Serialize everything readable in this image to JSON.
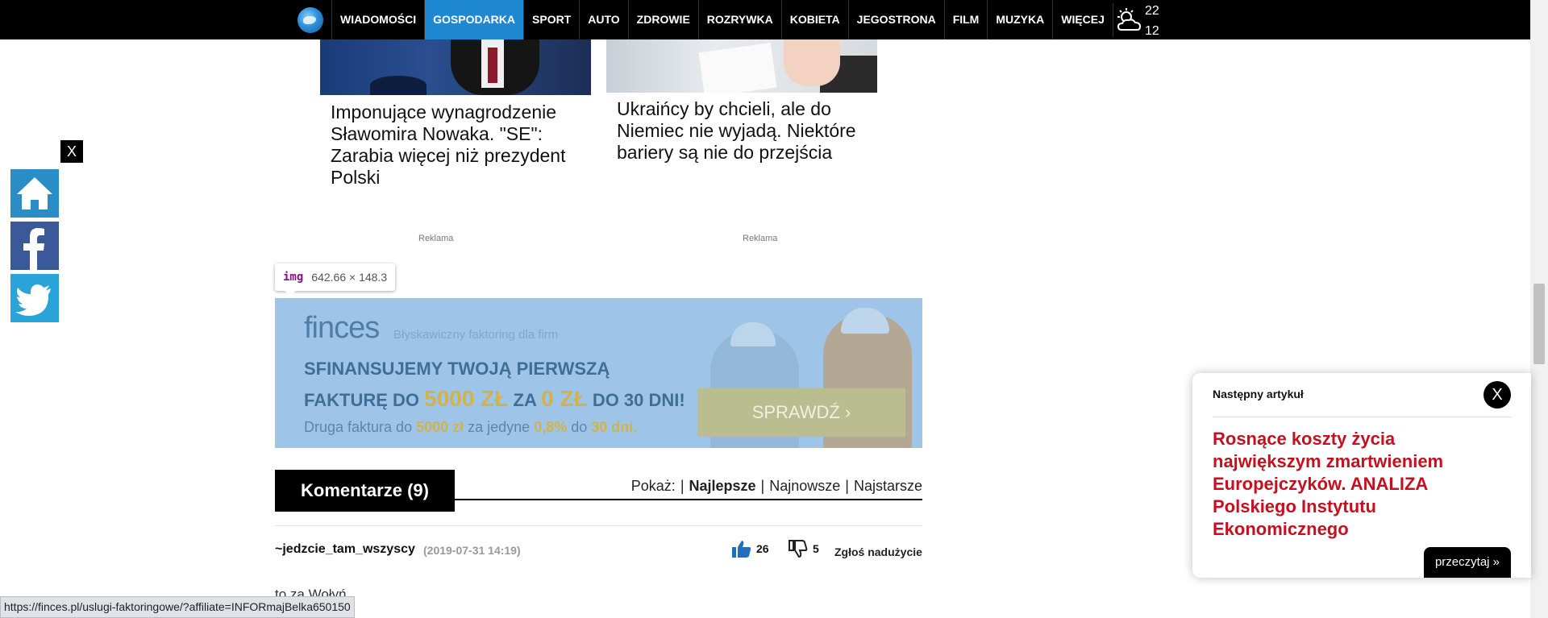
{
  "nav": {
    "items": [
      {
        "label": "WIADOMOŚCI",
        "active": false
      },
      {
        "label": "GOSPODARKA",
        "active": true
      },
      {
        "label": "SPORT",
        "active": false
      },
      {
        "label": "AUTO",
        "active": false
      },
      {
        "label": "ZDROWIE",
        "active": false
      },
      {
        "label": "ROZRYWKA",
        "active": false
      },
      {
        "label": "KOBIETA",
        "active": false
      },
      {
        "label": "JEGOSTRONA",
        "active": false
      },
      {
        "label": "FILM",
        "active": false
      },
      {
        "label": "MUZYKA",
        "active": false
      },
      {
        "label": "WIĘCEJ",
        "active": false
      }
    ],
    "weather": {
      "high": "22",
      "low": "12",
      "icon": "partly-cloudy-icon"
    },
    "accent": "#1e88d2"
  },
  "social": {
    "close_label": "X",
    "buttons": [
      "home-icon",
      "facebook-icon",
      "twitter-icon"
    ]
  },
  "articles": [
    {
      "title": "Imponujące wynagrodzenie Sławomira Nowaka. \"SE\": Zarabia więcej niż prezydent Polski"
    },
    {
      "title": "Ukraińcy by chcieli, ale do Niemiec nie wyjadą. Niektóre bariery są nie do przejścia"
    }
  ],
  "ads": {
    "label_left": "Reklama",
    "label_right": "Reklama"
  },
  "tooltip": {
    "tag": "img",
    "dimensions": "642.66 × 148.3"
  },
  "banner": {
    "logo": "finces",
    "tagline": "Błyskawiczny faktoring dla firm",
    "headline1": "SFINANSUJEMY TWOJĄ PIERWSZĄ",
    "headline2_a": "FAKTURĘ DO ",
    "headline2_b": "5000 ZŁ",
    "headline2_c": " ZA ",
    "headline2_d": "0 ZŁ",
    "headline2_e": " DO 30 DNI!",
    "sub_a": "Druga faktura do ",
    "sub_b": "5000 zł",
    "sub_c": " za jedyne ",
    "sub_d": "0,8%",
    "sub_e": " do ",
    "sub_f": "30 dni.",
    "cta": "SPRAWDŹ ›"
  },
  "comments": {
    "title": "Komentarze (9)",
    "show_label": "Pokaż:",
    "sort_options": [
      {
        "label": "Najlepsze",
        "active": true
      },
      {
        "label": "Najnowsze",
        "active": false
      },
      {
        "label": "Najstarsze",
        "active": false
      }
    ],
    "items": [
      {
        "author": "~jedzcie_tam_wszyscy",
        "date": "(2019-07-31 14:19)",
        "likes": "26",
        "dislikes": "5",
        "report": "Zgłoś nadużycie",
        "text": "to za Wołyń"
      }
    ]
  },
  "status_url": "https://finces.pl/uslugi-faktoringowe/?affiliate=INFORmajBelka650150",
  "next_article": {
    "label": "Następny artykuł",
    "close": "X",
    "headline": "Rosnące koszty życia największym zmartwieniem Europejczyków. ANALIZA Polskiego Instytutu Ekonomicznego",
    "read_label": "przeczytaj »",
    "headline_color": "#c4101f"
  }
}
